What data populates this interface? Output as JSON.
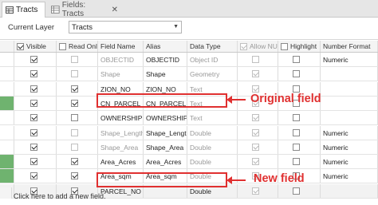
{
  "tabs": [
    {
      "label": "Tracts",
      "icon": "table-icon"
    },
    {
      "label": "Fields: Tracts",
      "icon": "fields-view-icon",
      "close": "✕"
    }
  ],
  "layer": {
    "label": "Current Layer",
    "value": "Tracts"
  },
  "columns": [
    "Visible",
    "Read Only",
    "Field Name",
    "Alias",
    "Data Type",
    "Allow NULL",
    "Highlight",
    "Number Format"
  ],
  "rows": [
    {
      "visible": true,
      "readonly": false,
      "name": "OBJECTID",
      "alias": "OBJECTID",
      "type": "Object ID",
      "allownull": false,
      "highlight": false,
      "format": "Numeric",
      "dim": true
    },
    {
      "visible": true,
      "readonly": false,
      "name": "Shape",
      "alias": "Shape",
      "type": "Geometry",
      "allownull": true,
      "highlight": false,
      "format": "",
      "dim": true
    },
    {
      "visible": true,
      "readonly": true,
      "name": "ZION_NO",
      "alias": "ZION_NO",
      "type": "Text",
      "allownull": true,
      "highlight": false,
      "format": "",
      "dim": false
    },
    {
      "visible": true,
      "readonly": true,
      "name": "CN_PARCEL_",
      "alias": "CN_PARCEL_",
      "type": "Text",
      "allownull": true,
      "highlight": false,
      "format": "",
      "dim": false
    },
    {
      "visible": true,
      "readonly": false,
      "name": "OWNERSHIP",
      "alias": "OWNERSHIP",
      "type": "Text",
      "allownull": true,
      "highlight": false,
      "format": "",
      "dim": false
    },
    {
      "visible": true,
      "readonly": false,
      "name": "Shape_Length",
      "alias": "Shape_Length",
      "type": "Double",
      "allownull": true,
      "highlight": false,
      "format": "Numeric",
      "dim": true
    },
    {
      "visible": true,
      "readonly": false,
      "name": "Shape_Area",
      "alias": "Shape_Area",
      "type": "Double",
      "allownull": true,
      "highlight": false,
      "format": "Numeric",
      "dim": true
    },
    {
      "visible": true,
      "readonly": true,
      "name": "Area_Acres",
      "alias": "Area_Acres",
      "type": "Double",
      "allownull": true,
      "highlight": false,
      "format": "Numeric",
      "dim": false
    },
    {
      "visible": true,
      "readonly": true,
      "name": "Area_sqm",
      "alias": "Area_sqm",
      "type": "Double",
      "allownull": true,
      "highlight": false,
      "format": "Numeric",
      "dim": false
    },
    {
      "visible": true,
      "readonly": true,
      "name": "PARCEL_NO",
      "alias": "",
      "type": "Double",
      "allownull": true,
      "highlight": false,
      "format": "",
      "dim": false
    }
  ],
  "footer": "Click here to add a new field.",
  "annotations": {
    "original": "Original field",
    "new": "New field"
  },
  "colors": {
    "annotation": "#e03030",
    "row_marker": "#6fb36f"
  }
}
